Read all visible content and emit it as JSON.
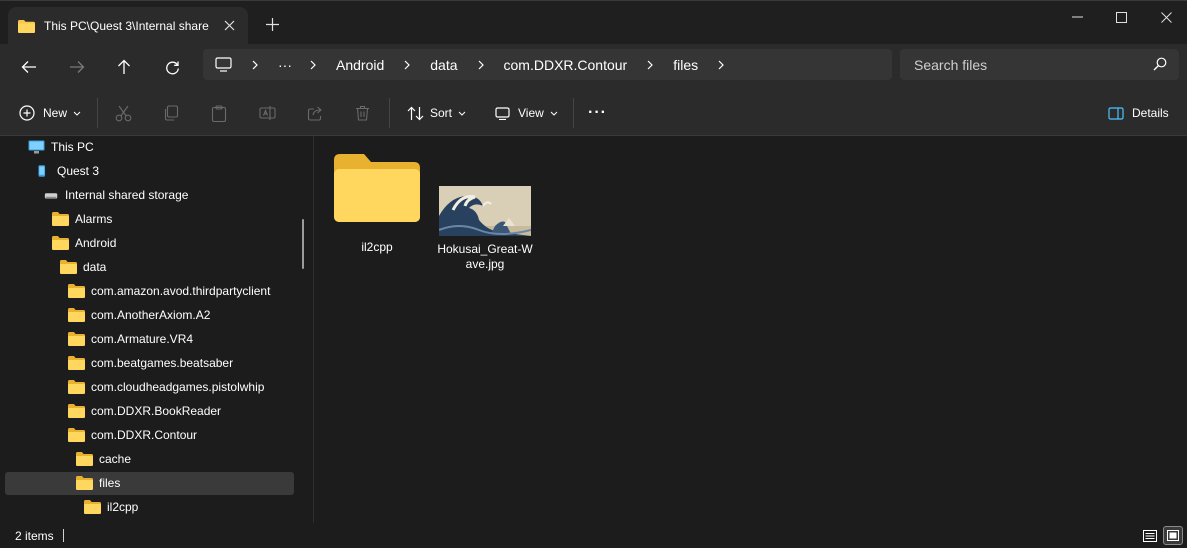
{
  "tab": {
    "title": "This PC\\Quest 3\\Internal share"
  },
  "breadcrumb": {
    "more": "···",
    "items": [
      "Android",
      "data",
      "com.DDXR.Contour",
      "files"
    ]
  },
  "search": {
    "placeholder": "Search files"
  },
  "toolbar": {
    "new_label": "New",
    "sort_label": "Sort",
    "view_label": "View",
    "more_label": "···",
    "details_label": "Details"
  },
  "sidebar": {
    "items": [
      {
        "label": "This PC",
        "icon": "monitor-icon"
      },
      {
        "label": "Quest 3",
        "icon": "device-icon"
      },
      {
        "label": "Internal shared storage",
        "icon": "drive-icon"
      },
      {
        "label": "Alarms",
        "icon": "folder-icon"
      },
      {
        "label": "Android",
        "icon": "folder-icon"
      },
      {
        "label": "data",
        "icon": "folder-icon"
      },
      {
        "label": "com.amazon.avod.thirdpartyclient",
        "icon": "folder-icon"
      },
      {
        "label": "com.AnotherAxiom.A2",
        "icon": "folder-icon"
      },
      {
        "label": "com.Armature.VR4",
        "icon": "folder-icon"
      },
      {
        "label": "com.beatgames.beatsaber",
        "icon": "folder-icon"
      },
      {
        "label": "com.cloudheadgames.pistolwhip",
        "icon": "folder-icon"
      },
      {
        "label": "com.DDXR.BookReader",
        "icon": "folder-icon"
      },
      {
        "label": "com.DDXR.Contour",
        "icon": "folder-icon"
      },
      {
        "label": "cache",
        "icon": "folder-icon"
      },
      {
        "label": "files",
        "icon": "folder-icon",
        "selected": true
      },
      {
        "label": "il2cpp",
        "icon": "folder-icon"
      }
    ]
  },
  "content": {
    "items": [
      {
        "name": "il2cpp",
        "type": "folder"
      },
      {
        "name": "Hokusai_Great-Wave.jpg",
        "type": "image",
        "line1": "Hokusai_Great-W",
        "line2": "ave.jpg"
      }
    ]
  },
  "status": {
    "count": "2 items"
  },
  "colors": {
    "accent": "#4cc2ff",
    "folder": "#f7c948",
    "background": "#1c1c1c",
    "bar": "#2b2b2b"
  }
}
